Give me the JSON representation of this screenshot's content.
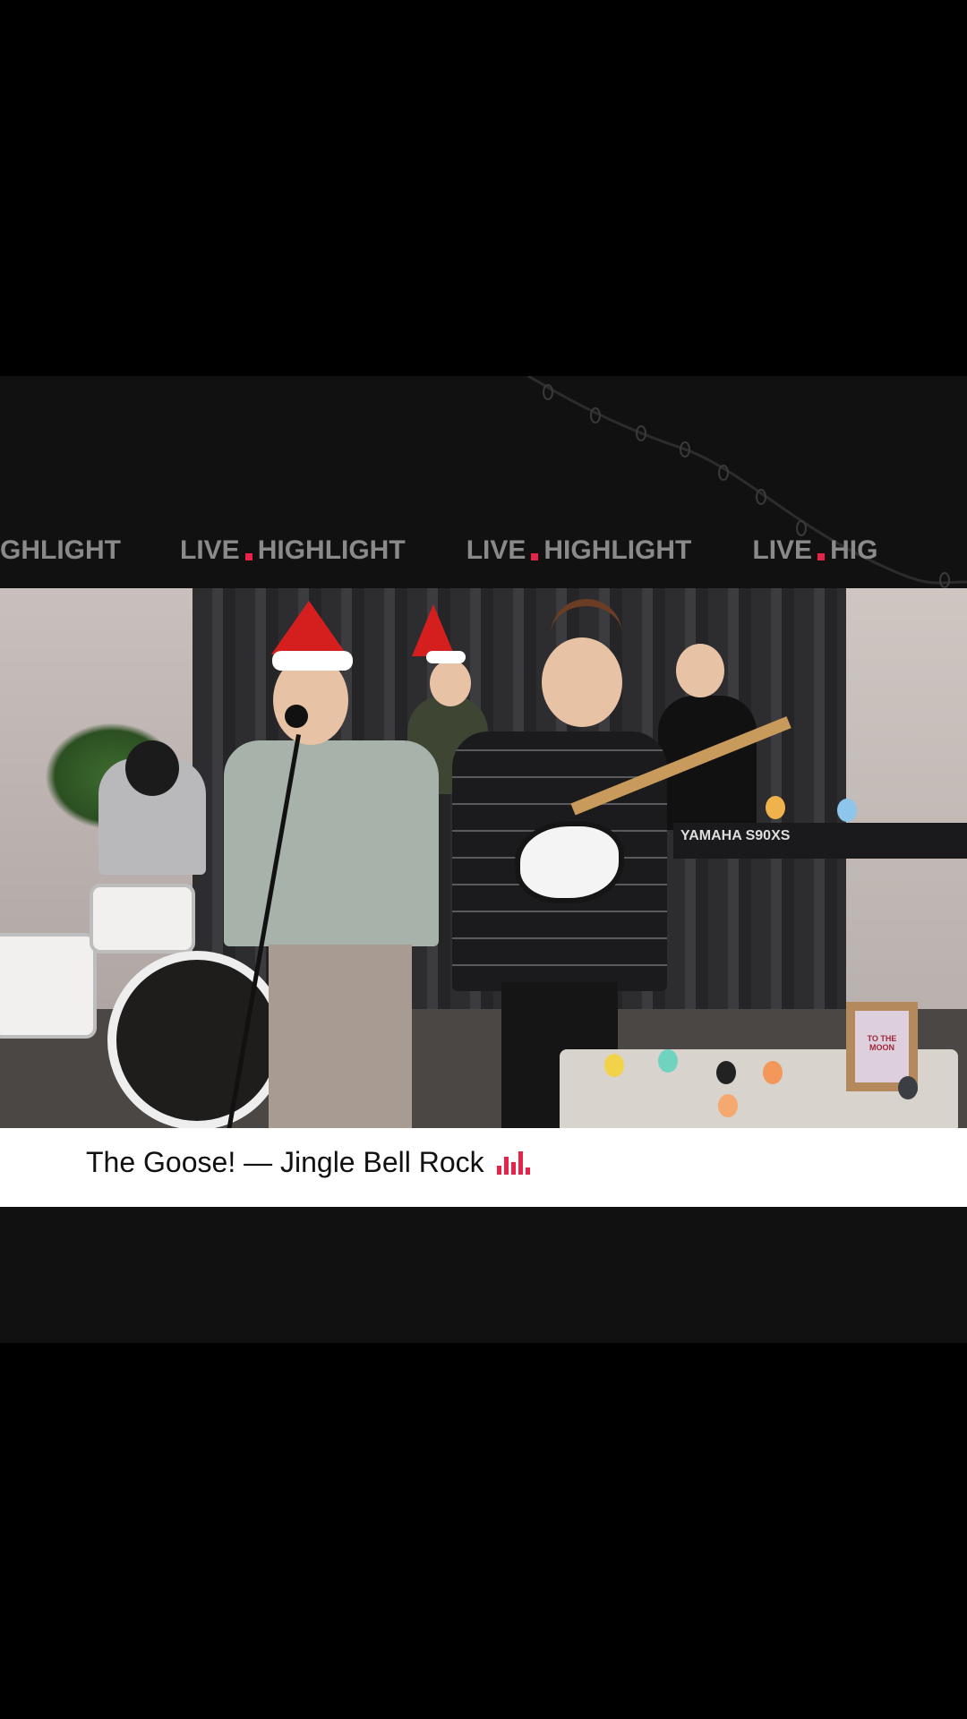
{
  "banner": {
    "marquee": [
      {
        "word1": "",
        "word2": "GHLIGHT"
      },
      {
        "word1": "LIVE",
        "word2": "HIGHLIGHT"
      },
      {
        "word1": "LIVE",
        "word2": "HIGHLIGHT"
      },
      {
        "word1": "LIVE",
        "word2": "HIG"
      }
    ],
    "accent_color": "#e8234a"
  },
  "video": {
    "keyboard_label": "YAMAHA  S90XS",
    "sign_text": "TO THE MOON"
  },
  "caption": {
    "title": "The Goose! — Jingle Bell Rock",
    "icon": "equalizer-icon",
    "icon_color": "#e8234a"
  }
}
